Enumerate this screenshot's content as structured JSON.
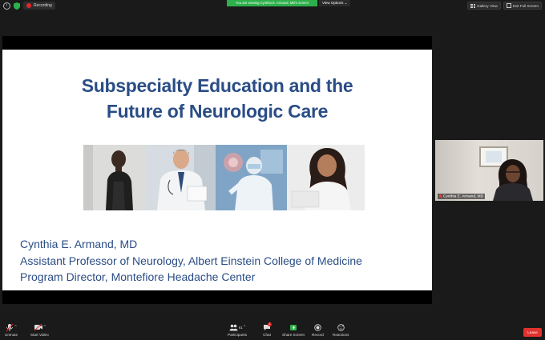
{
  "topbar": {
    "recording_label": "Recording",
    "viewing_banner": "You are viewing Cynthia E. Armand, MD's screen",
    "view_options_label": "View Options ⌄",
    "gallery_view_label": "Gallery View",
    "exit_full_screen_label": "Exit Full Screen"
  },
  "slide": {
    "title_line1": "Subspecialty Education and the",
    "title_line2": "Future of Neurologic Care",
    "presenter_name": "Cynthia E. Armand, MD",
    "presenter_title1": "Assistant Professor of Neurology, Albert Einstein College of Medicine",
    "presenter_title2": "Program Director, Montefiore Headache Center"
  },
  "thumbnail": {
    "name": "Cynthia E. Armand, MD"
  },
  "toolbar": {
    "unmute_label": "Unmute",
    "start_video_label": "Start Video",
    "participants_label": "Participants",
    "participants_count": "61",
    "chat_label": "Chat",
    "chat_badge": "1",
    "share_screen_label": "Share Screen",
    "record_label": "Record",
    "reactions_label": "Reactions",
    "leave_label": "Leave"
  },
  "colors": {
    "title_blue": "#2a4d86",
    "banner_green": "#2db04b",
    "leave_red": "#e0322f"
  }
}
